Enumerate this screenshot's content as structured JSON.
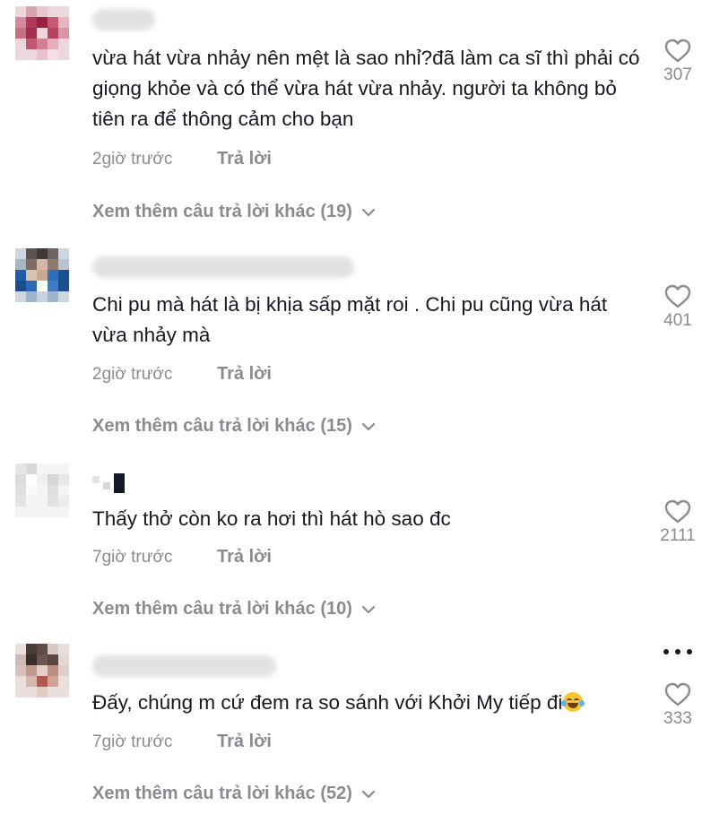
{
  "comments": [
    {
      "text": "vừa hát vừa nhảy nên mệt là sao nhỉ?đã làm ca sĩ thì phải có giọng khỏe và có thể vừa hát vừa nhảy. người ta không bỏ tiên ra để thông cảm cho bạn",
      "time": "2giờ trước",
      "reply_label": "Trả lời",
      "more_replies": "Xem thêm câu trả lời khác (19)",
      "likes": "307"
    },
    {
      "text": "Chi pu mà hát là bị khịa sấp mặt roi . Chi pu cũng vừa hát vừa nhảy mà",
      "time": "2giờ trước",
      "reply_label": "Trả lời",
      "more_replies": "Xem thêm câu trả lời khác (15)",
      "likes": "401"
    },
    {
      "text": "Thấy thở còn ko ra hơi thì hát hò sao đc",
      "time": "7giờ trước",
      "reply_label": "Trả lời",
      "more_replies": "Xem thêm câu trả lời khác (10)",
      "likes": "2111"
    },
    {
      "text": "Đấy, chúng m cứ đem ra so sánh với Khởi My tiếp đi",
      "emoji": "laughing-tears-emoji",
      "time": "7giờ trước",
      "reply_label": "Trả lời",
      "more_replies": "Xem thêm câu trả lời khác (52)",
      "likes": "333"
    }
  ],
  "colors": {
    "text": "#161823",
    "secondary": "#8a8b91",
    "background": "#ffffff"
  },
  "icons": {
    "like": "heart-outline-icon",
    "expand": "chevron-down-icon",
    "options": "more-options-icon"
  }
}
